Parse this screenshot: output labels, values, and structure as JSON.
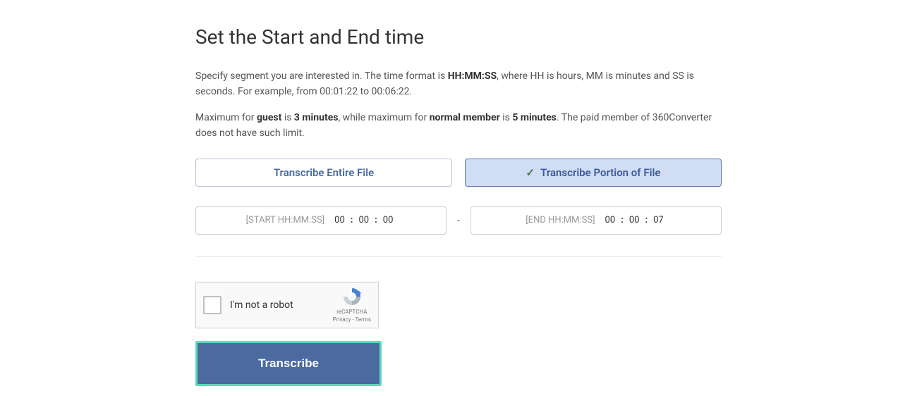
{
  "heading": "Set the Start and End time",
  "description1_prefix": "Specify segment you are interested in. The time format is ",
  "description1_format": "HH:MM:SS",
  "description1_suffix": ", where HH is hours, MM is minutes and SS is seconds. For example, from 00:01:22 to 00:06:22.",
  "description2_p1": "Maximum for ",
  "description2_guest": "guest",
  "description2_p2": " is ",
  "description2_guest_limit": "3 minutes",
  "description2_p3": ", while maximum for ",
  "description2_member": "normal member",
  "description2_p4": " is ",
  "description2_member_limit": "5 minutes",
  "description2_suffix": ". The paid member of 360Converter does not have such limit.",
  "tabs": {
    "entire": "Transcribe Entire File",
    "portion": "Transcribe Portion of File"
  },
  "start": {
    "placeholder": "[START HH:MM:SS]",
    "hh": "00",
    "mm": "00",
    "ss": "00"
  },
  "end": {
    "placeholder": "[END HH:MM:SS]",
    "hh": "00",
    "mm": "00",
    "ss": "07"
  },
  "separator": "-",
  "colon": ":",
  "captcha": {
    "label": "I'm not a robot",
    "brand": "reCAPTCHA",
    "terms": "Privacy - Terms"
  },
  "submit_label": "Transcribe"
}
